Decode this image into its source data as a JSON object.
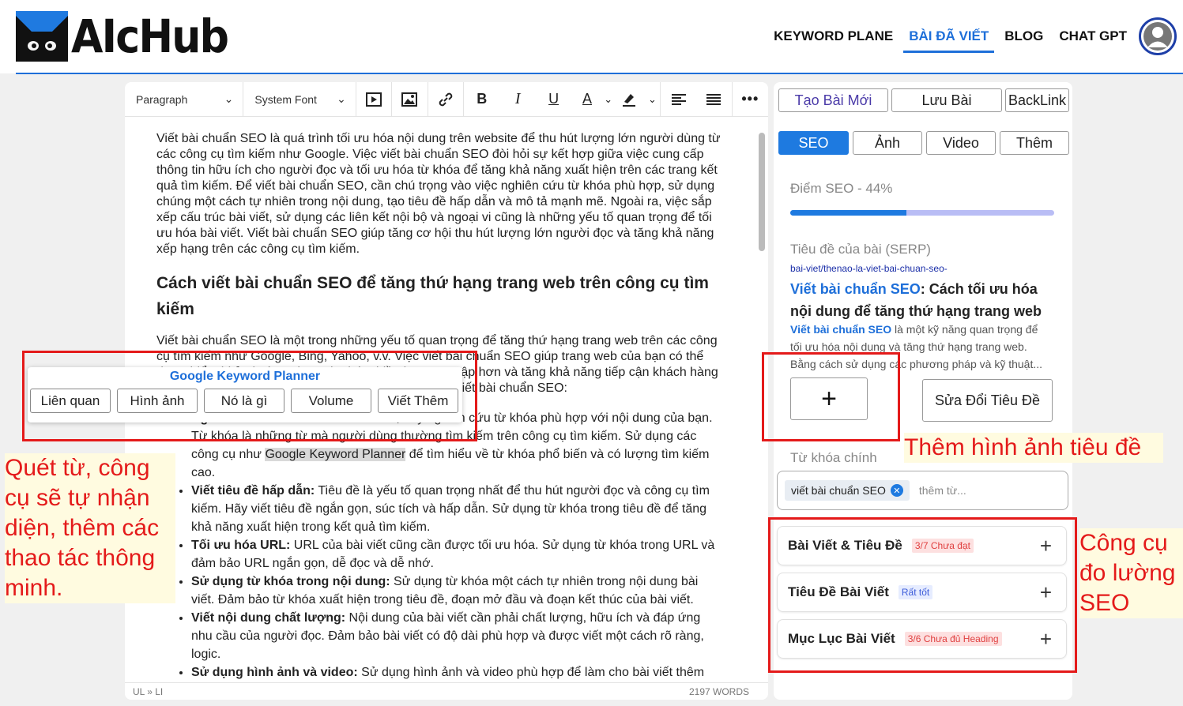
{
  "header": {
    "logo_text": "AIcHub",
    "nav": [
      "KEYWORD PLANE",
      "BÀI ĐÃ VIẾT",
      "BLOG",
      "CHAT GPT"
    ],
    "active_nav": "BÀI ĐÃ VIẾT",
    "accent_color": "#1e6fd9"
  },
  "editor": {
    "toolbar": {
      "block_format": "Paragraph",
      "font": "System Font",
      "icons": [
        "media-icon",
        "image-icon",
        "link-icon",
        "bold-icon",
        "italic-icon",
        "underline-icon",
        "text-color-icon",
        "highlight-icon",
        "align-left-icon",
        "justify-icon",
        "more-icon"
      ]
    },
    "para1": "Viết bài chuẩn SEO là quá trình tối ưu hóa nội dung trên website để thu hút lượng lớn người dùng từ các công cụ tìm kiếm như Google. Việc viết bài chuẩn SEO đòi hỏi sự kết hợp giữa việc cung cấp thông tin hữu ích cho người đọc và tối ưu hóa từ khóa để tăng khả năng xuất hiện trên các trang kết quả tìm kiếm. Để viết bài chuẩn SEO, cần chú trọng vào việc nghiên cứu từ khóa phù hợp, sử dụng chúng một cách tự nhiên trong nội dung, tạo tiêu đề hấp dẫn và mô tả mạnh mẽ. Ngoài ra, việc sắp xếp cấu trúc bài viết, sử dụng các liên kết nội bộ và ngoại vi cũng là những yếu tố quan trọng để tối ưu hóa bài viết. Viết bài chuẩn SEO giúp tăng cơ hội thu hút lượng lớn người đọc và tăng khả năng xếp hạng trên các công cụ tìm kiếm.",
    "heading": "Cách viết bài chuẩn SEO để tăng thứ hạng trang web trên công cụ tìm kiếm",
    "para2": "Viết bài chuẩn SEO là một trong những yếu tố quan trọng để tăng thứ hạng trang web trên các công cụ tìm kiếm như Google, Bing, Yahoo, v.v. Việc viết bài chuẩn SEO giúp trang web của bạn có thể được hiển thị ở vị trí cao hơn, thu hút nhiều lượt truy cập hơn và tăng khả năng tiếp cận khách hàng tiềm năng. Dưới đây là một số nguyên tắc cơ bản để viết bài chuẩn SEO:",
    "list": [
      {
        "bold": "Nghiên cứu từ khóa:",
        "pre": " Trước khi viết, hãy nghiên cứu từ khóa phù hợp với nội dung của bạn. Từ khóa là những từ mà người dùng thường tìm kiếm trên công cụ tìm kiếm. Sử dụng các công cụ như ",
        "highlight": "Google Keyword Planner",
        "post": " để tìm hiểu về từ khóa phổ biến và có lượng tìm kiếm cao."
      },
      {
        "bold": "Viết tiêu đề hấp dẫn:",
        "pre": " Tiêu đề là yếu tố quan trọng nhất để thu hút người đọc và công cụ tìm kiếm. Hãy viết tiêu đề ngắn gọn, súc tích và hấp dẫn. Sử dụng từ khóa trong tiêu đề để tăng khả năng xuất hiện trong kết quả tìm kiếm.",
        "highlight": "",
        "post": ""
      },
      {
        "bold": "Tối ưu hóa URL:",
        "pre": " URL của bài viết cũng cần được tối ưu hóa. Sử dụng từ khóa trong URL và đảm bảo URL ngắn gọn, dễ đọc và dễ nhớ.",
        "highlight": "",
        "post": ""
      },
      {
        "bold": "Sử dụng từ khóa trong nội dung:",
        "pre": " Sử dụng từ khóa một cách tự nhiên trong nội dung bài viết. Đảm bảo từ khóa xuất hiện trong tiêu đề, đoạn mở đầu và đoạn kết thúc của bài viết.",
        "highlight": "",
        "post": ""
      },
      {
        "bold": "Viết nội dung chất lượng:",
        "pre": " Nội dung của bài viết cần phải chất lượng, hữu ích và đáp ứng nhu cầu của người đọc. Đảm bảo bài viết có độ dài phù hợp và được viết một cách rõ ràng, logic.",
        "highlight": "",
        "post": ""
      },
      {
        "bold": "Sử dụng hình ảnh và video:",
        "pre": " Sử dụng hình ảnh và video phù hợp để làm cho bài viết thêm",
        "highlight": "",
        "post": ""
      }
    ],
    "status_path": "UL » LI",
    "word_count": "2197 WORDS"
  },
  "popup": {
    "title": "Google Keyword Planner",
    "buttons": [
      "Liên quan",
      "Hình ảnh",
      "Nó là gì",
      "Volume",
      "Viết Thêm"
    ]
  },
  "annotations": {
    "left": "Quét từ, công cụ sẽ tự nhận diện, thêm các thao tác thông minh.",
    "title_image": "Thêm hình ảnh tiêu đề",
    "seo_tools": "Công cụ đo lường SEO",
    "color": "#e41a1a"
  },
  "panel": {
    "top_buttons": [
      "Tạo Bài Mới",
      "Lưu Bài",
      "BackLink"
    ],
    "tabs": [
      "SEO",
      "Ảnh",
      "Video",
      "Thêm"
    ],
    "active_tab": "SEO",
    "seo_score_label": "Điểm SEO - 44%",
    "seo_score": 0.44,
    "serp_label": "Tiêu đề của bài (SERP)",
    "serp_url": "bai-viet/thenao-la-viet-bai-chuan-seo-",
    "serp_title_kw": "Viết bài chuẩn SEO",
    "serp_title_rest": ": Cách tối ưu hóa nội dung để tăng thứ hạng trang web",
    "serp_desc_kw": "Viết bài chuẩn SEO",
    "serp_desc_rest": " là một kỹ năng quan trọng để tối ưu hóa nội dung và tăng thứ hạng trang web. Bằng cách sử dụng các phương pháp và kỹ thuật...",
    "add_symbol": "+",
    "edit_title_button": "Sửa Đổi Tiêu Đề",
    "keyword_label": "Từ khóa chính",
    "keyword_chip": "viết bài chuẩn SEO",
    "keyword_placeholder": "thêm từ...",
    "accordions": [
      {
        "title": "Bài Viết & Tiêu Đề",
        "badge": "3/7 Chưa đạt",
        "badge_type": "red"
      },
      {
        "title": "Tiêu Đề Bài Viết",
        "badge": "Rất tốt",
        "badge_type": "blue"
      },
      {
        "title": "Mục Lục Bài Viết",
        "badge": "3/6 Chưa đủ Heading",
        "badge_type": "red"
      }
    ]
  }
}
